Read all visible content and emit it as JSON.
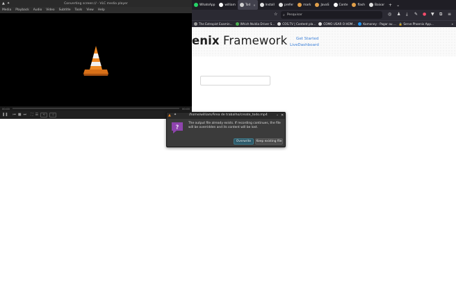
{
  "browser": {
    "tabs": [
      {
        "label": "WhatsApp",
        "sublabel": "",
        "color": "#25d366",
        "active": false
      },
      {
        "label": "william",
        "color": "#ffffff",
        "active": false
      },
      {
        "label": "Tod",
        "color": "#cfcfcf",
        "active": true
      },
      {
        "label": "Install",
        "color": "#e0e0e0",
        "active": false
      },
      {
        "label": "prefer",
        "color": "#e0e0e0",
        "active": false
      },
      {
        "label": "mark",
        "color": "#e2a04a",
        "active": false
      },
      {
        "label": "JavaS",
        "color": "#e2a04a",
        "active": false
      },
      {
        "label": "Conte",
        "color": "#ffffff",
        "active": false
      },
      {
        "label": "flash",
        "color": "#e2a04a",
        "active": false
      },
      {
        "label": "Baixar",
        "color": "#e0e0e0",
        "active": false
      }
    ],
    "new_tab": "+",
    "tab_list": "⌄",
    "search_placeholder": "Pesquisar",
    "bookmarks": [
      {
        "label": "The Extropist Examin...",
        "color": "#9a9a9a"
      },
      {
        "label": "Which Nvidia Driver S...",
        "color": "#4caf50"
      },
      {
        "label": "COS.TV | Content pla...",
        "color": "#e0e0e0"
      },
      {
        "label": "COMO USAR O HOM...",
        "color": "#e0e0e0"
      },
      {
        "label": "Kamoney - Pagar ou ...",
        "color": "#2196f3"
      },
      {
        "label": "🔒 Serve Phoenix App...",
        "color": "#e0e0e0"
      }
    ],
    "bookmarks_more": "»",
    "page": {
      "title_bold": "enix",
      "title_rest": " Framework",
      "link_get_started": "Get Started",
      "link_live_dashboard": "LiveDashboard"
    }
  },
  "vlc": {
    "title": "Converting screen:// - VLC media player",
    "menu": [
      "Media",
      "Playback",
      "Audio",
      "Video",
      "Subtitle",
      "Tools",
      "View",
      "Help"
    ],
    "time_elapsed": "00:00",
    "time_total": "00:00",
    "seek_label": "--:--"
  },
  "dialog": {
    "title": "/home/william/Área de trabalho/create_todo.mp4",
    "message": "The output file already exists. If recording continues, the file will be overridden and its content will be lost.",
    "overwrite_label": "Overwrite",
    "keep_label": "Keep existing file",
    "minimize": "⌄",
    "close": "✕"
  },
  "colors": {
    "accent_link": "#3a7fd8",
    "dialog_primary": "#2e5a6a",
    "vlc_cone": "#f08a24"
  }
}
